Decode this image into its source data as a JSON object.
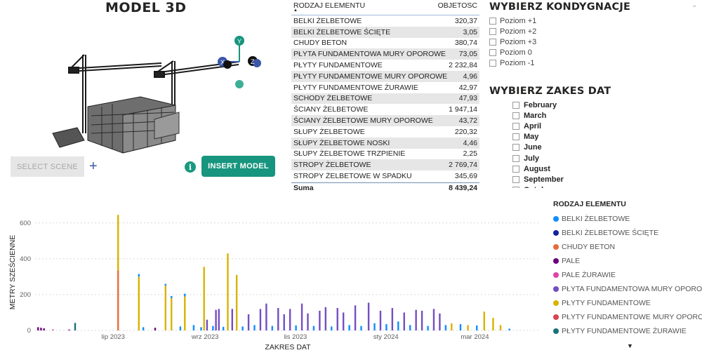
{
  "model": {
    "title": "MODEL 3D",
    "select_scene_label": "SELECT SCENE",
    "add_label": "+",
    "info_label": "i",
    "insert_model_label": "INSERT MODEL",
    "gizmo": {
      "y": "Y",
      "x": "X",
      "z": "Z"
    }
  },
  "table": {
    "col_element": "RODZAJ ELEMENTU",
    "col_volume": "OBJETOSC",
    "rows": [
      {
        "name": "BELKI ŻELBETOWE",
        "value": "320,37"
      },
      {
        "name": "BELKI ŻELBETOWE ŚCIĘTE",
        "value": "3,05"
      },
      {
        "name": "CHUDY BETON",
        "value": "380,74"
      },
      {
        "name": "PŁYTA FUNDAMENTOWA MURY OPOROWE",
        "value": "73,05"
      },
      {
        "name": "PŁYTY FUNDAMENTOWE",
        "value": "2 232,84"
      },
      {
        "name": "PŁYTY FUNDAMENTOWE MURY OPOROWE",
        "value": "4,96"
      },
      {
        "name": "PŁYTY FUNDAMENTOWE ŻURAWIE",
        "value": "42,97"
      },
      {
        "name": "SCHODY ŻELBETOWE",
        "value": "47,93"
      },
      {
        "name": "ŚCIANY ŻELBETOWE",
        "value": "1 947,14"
      },
      {
        "name": "ŚCIANY ŻELBETOWE MURY OPOROWE",
        "value": "43,72"
      },
      {
        "name": "SŁUPY ŻELBETOWE",
        "value": "220,32"
      },
      {
        "name": "SŁUPY ŻELBETOWE NOSKI",
        "value": "4,46"
      },
      {
        "name": "SŁUPY ŻELBETOWE TRZPIENIE",
        "value": "2,25"
      },
      {
        "name": "STROPY ŻELBETOWE",
        "value": "2 769,74"
      },
      {
        "name": "STROPY ŻELBETOWE W SPADKU",
        "value": "345,69"
      }
    ],
    "total_label": "Suma",
    "total_value": "8 439,24"
  },
  "kondygnacje": {
    "title": "WYBIERZ KONDYGNACJE",
    "items": [
      "Poziom +1",
      "Poziom +2",
      "Poziom +3",
      "Poziom 0",
      "Poziom -1"
    ]
  },
  "daty": {
    "title": "WYBIERZ ZAKES DAT",
    "items": [
      "February",
      "March",
      "April",
      "May",
      "June",
      "July",
      "August",
      "September",
      "October"
    ]
  },
  "legend": {
    "title": "RODZAJ ELEMENTU",
    "items": [
      {
        "name": "BELKI ŻELBETOWE",
        "color": "#118dff"
      },
      {
        "name": "BELKI ŻELBETOWE ŚCIĘTE",
        "color": "#12239e"
      },
      {
        "name": "CHUDY BETON",
        "color": "#e66c37"
      },
      {
        "name": "PALE",
        "color": "#6b007b"
      },
      {
        "name": "PALE ŻURAWIE",
        "color": "#e044a7"
      },
      {
        "name": "PŁYTA FUNDAMENTOWA MURY OPOROWE",
        "color": "#744ec2"
      },
      {
        "name": "PŁYTY FUNDAMENTOWE",
        "color": "#d9b300"
      },
      {
        "name": "PŁYTY FUNDAMENTOWE MURY OPOROWE",
        "color": "#d64550"
      },
      {
        "name": "PŁYTY FUNDAMENTOWE ŻURAWIE",
        "color": "#197278"
      }
    ]
  },
  "chart_data": {
    "type": "bar",
    "stacked": true,
    "xlabel": "ZAKRES DAT",
    "ylabel": "METRY SZEŚCIENNE",
    "ylim": [
      0,
      650
    ],
    "yticks": [
      "0",
      "200",
      "400",
      "600"
    ],
    "xticks": [
      "lip 2023",
      "wrz 2023",
      "lis 2023",
      "sty 2024",
      "mar 2024"
    ],
    "xrange": [
      "2023-05-15",
      "2024-04-20"
    ],
    "grid": true,
    "bars": [
      {
        "date": "2023-05-17",
        "series": "PALE",
        "value": 18
      },
      {
        "date": "2023-05-19",
        "series": "PALE",
        "value": 15
      },
      {
        "date": "2023-05-21",
        "series": "PALE",
        "value": 12
      },
      {
        "date": "2023-05-27",
        "series": "PALE ŻURAWIE",
        "value": 6
      },
      {
        "date": "2023-06-07",
        "series": "PALE",
        "value": 5
      },
      {
        "date": "2023-06-11",
        "series": "PŁYTY FUNDAMENTOWE ŻURAWIE",
        "value": 42
      },
      {
        "date": "2023-07-10",
        "series": "CHUDY BETON",
        "value": 335
      },
      {
        "date": "2023-07-10",
        "series": "PŁYTY FUNDAMENTOWE",
        "value": 310
      },
      {
        "date": "2023-07-24",
        "series": "PŁYTY FUNDAMENTOWE",
        "value": 300
      },
      {
        "date": "2023-07-24",
        "series": "BELKI ŻELBETOWE",
        "value": 15
      },
      {
        "date": "2023-07-27",
        "series": "BELKI ŻELBETOWE",
        "value": 18
      },
      {
        "date": "2023-08-04",
        "series": "PALE",
        "value": 15
      },
      {
        "date": "2023-08-11",
        "series": "PŁYTY FUNDAMENTOWE",
        "value": 250
      },
      {
        "date": "2023-08-11",
        "series": "BELKI ŻELBETOWE",
        "value": 10
      },
      {
        "date": "2023-08-15",
        "series": "PŁYTY FUNDAMENTOWE",
        "value": 180
      },
      {
        "date": "2023-08-15",
        "series": "BELKI ŻELBETOWE",
        "value": 12
      },
      {
        "date": "2023-08-21",
        "series": "BELKI ŻELBETOWE",
        "value": 22
      },
      {
        "date": "2023-08-24",
        "series": "PŁYTY FUNDAMENTOWE",
        "value": 190
      },
      {
        "date": "2023-08-24",
        "series": "BELKI ŻELBETOWE",
        "value": 15
      },
      {
        "date": "2023-08-30",
        "series": "BELKI ŻELBETOWE",
        "value": 30
      },
      {
        "date": "2023-09-04",
        "series": "BELKI ŻELBETOWE",
        "value": 18
      },
      {
        "date": "2023-09-06",
        "series": "PŁYTY FUNDAMENTOWE",
        "value": 355
      },
      {
        "date": "2023-09-08",
        "series": "PŁYTA FUNDAMENTOWA MURY OPOROWE",
        "value": 60
      },
      {
        "date": "2023-09-12",
        "series": "BELKI ŻELBETOWE",
        "value": 25
      },
      {
        "date": "2023-09-14",
        "series": "PŁYTA FUNDAMENTOWA MURY OPOROWE",
        "value": 115
      },
      {
        "date": "2023-09-16",
        "series": "PŁYTA FUNDAMENTOWA MURY OPOROWE",
        "value": 120
      },
      {
        "date": "2023-09-19",
        "series": "BELKI ŻELBETOWE",
        "value": 20
      },
      {
        "date": "2023-09-22",
        "series": "PŁYTY FUNDAMENTOWE",
        "value": 430
      },
      {
        "date": "2023-09-25",
        "series": "PŁYTA FUNDAMENTOWA MURY OPOROWE",
        "value": 120
      },
      {
        "date": "2023-09-28",
        "series": "PŁYTY FUNDAMENTOWE",
        "value": 310
      },
      {
        "date": "2023-10-02",
        "series": "BELKI ŻELBETOWE",
        "value": 22
      },
      {
        "date": "2023-10-06",
        "series": "PŁYTA FUNDAMENTOWA MURY OPOROWE",
        "value": 90
      },
      {
        "date": "2023-10-10",
        "series": "BELKI ŻELBETOWE",
        "value": 30
      },
      {
        "date": "2023-10-14",
        "series": "PŁYTA FUNDAMENTOWA MURY OPOROWE",
        "value": 120
      },
      {
        "date": "2023-10-18",
        "series": "PŁYTA FUNDAMENTOWA MURY OPOROWE",
        "value": 150
      },
      {
        "date": "2023-10-22",
        "series": "BELKI ŻELBETOWE",
        "value": 25
      },
      {
        "date": "2023-10-26",
        "series": "PŁYTA FUNDAMENTOWA MURY OPOROWE",
        "value": 125
      },
      {
        "date": "2023-10-30",
        "series": "PŁYTA FUNDAMENTOWA MURY OPOROWE",
        "value": 90
      },
      {
        "date": "2023-11-03",
        "series": "PŁYTA FUNDAMENTOWA MURY OPOROWE",
        "value": 120
      },
      {
        "date": "2023-11-07",
        "series": "BELKI ŻELBETOWE",
        "value": 28
      },
      {
        "date": "2023-11-11",
        "series": "PŁYTA FUNDAMENTOWA MURY OPOROWE",
        "value": 150
      },
      {
        "date": "2023-11-15",
        "series": "PŁYTA FUNDAMENTOWA MURY OPOROWE",
        "value": 95
      },
      {
        "date": "2023-11-19",
        "series": "BELKI ŻELBETOWE",
        "value": 25
      },
      {
        "date": "2023-11-23",
        "series": "PŁYTA FUNDAMENTOWA MURY OPOROWE",
        "value": 110
      },
      {
        "date": "2023-11-27",
        "series": "PŁYTA FUNDAMENTOWA MURY OPOROWE",
        "value": 130
      },
      {
        "date": "2023-12-01",
        "series": "BELKI ŻELBETOWE",
        "value": 22
      },
      {
        "date": "2023-12-05",
        "series": "PŁYTA FUNDAMENTOWA MURY OPOROWE",
        "value": 125
      },
      {
        "date": "2023-12-09",
        "series": "PŁYTA FUNDAMENTOWA MURY OPOROWE",
        "value": 100
      },
      {
        "date": "2023-12-13",
        "series": "BELKI ŻELBETOWE",
        "value": 30
      },
      {
        "date": "2023-12-17",
        "series": "PŁYTA FUNDAMENTOWA MURY OPOROWE",
        "value": 140
      },
      {
        "date": "2023-12-21",
        "series": "BELKI ŻELBETOWE",
        "value": 25
      },
      {
        "date": "2023-12-26",
        "series": "PŁYTA FUNDAMENTOWA MURY OPOROWE",
        "value": 155
      },
      {
        "date": "2023-12-30",
        "series": "BELKI ŻELBETOWE",
        "value": 40
      },
      {
        "date": "2024-01-03",
        "series": "PŁYTA FUNDAMENTOWA MURY OPOROWE",
        "value": 110
      },
      {
        "date": "2024-01-07",
        "series": "BELKI ŻELBETOWE",
        "value": 35
      },
      {
        "date": "2024-01-11",
        "series": "PŁYTA FUNDAMENTOWA MURY OPOROWE",
        "value": 125
      },
      {
        "date": "2024-01-15",
        "series": "BELKI ŻELBETOWE",
        "value": 50
      },
      {
        "date": "2024-01-19",
        "series": "PŁYTA FUNDAMENTOWA MURY OPOROWE",
        "value": 100
      },
      {
        "date": "2024-01-23",
        "series": "BELKI ŻELBETOWE",
        "value": 30
      },
      {
        "date": "2024-01-27",
        "series": "PŁYTA FUNDAMENTOWA MURY OPOROWE",
        "value": 115
      },
      {
        "date": "2024-01-31",
        "series": "PŁYTA FUNDAMENTOWA MURY OPOROWE",
        "value": 110
      },
      {
        "date": "2024-02-04",
        "series": "BELKI ŻELBETOWE",
        "value": 25
      },
      {
        "date": "2024-02-08",
        "series": "PŁYTA FUNDAMENTOWA MURY OPOROWE",
        "value": 120
      },
      {
        "date": "2024-02-12",
        "series": "PŁYTA FUNDAMENTOWA MURY OPOROWE",
        "value": 95
      },
      {
        "date": "2024-02-16",
        "series": "BELKI ŻELBETOWE",
        "value": 30
      },
      {
        "date": "2024-02-20",
        "series": "PŁYTY FUNDAMENTOWE",
        "value": 40
      },
      {
        "date": "2024-02-26",
        "series": "BELKI ŻELBETOWE",
        "value": 35
      },
      {
        "date": "2024-03-02",
        "series": "PŁYTY FUNDAMENTOWE",
        "value": 30
      },
      {
        "date": "2024-03-08",
        "series": "BELKI ŻELBETOWE",
        "value": 28
      },
      {
        "date": "2024-03-13",
        "series": "PŁYTY FUNDAMENTOWE",
        "value": 105
      },
      {
        "date": "2024-03-19",
        "series": "PŁYTY FUNDAMENTOWE",
        "value": 70
      },
      {
        "date": "2024-03-24",
        "series": "PŁYTY FUNDAMENTOWE",
        "value": 30
      },
      {
        "date": "2024-03-30",
        "series": "BELKI ŻELBETOWE",
        "value": 10
      }
    ]
  }
}
